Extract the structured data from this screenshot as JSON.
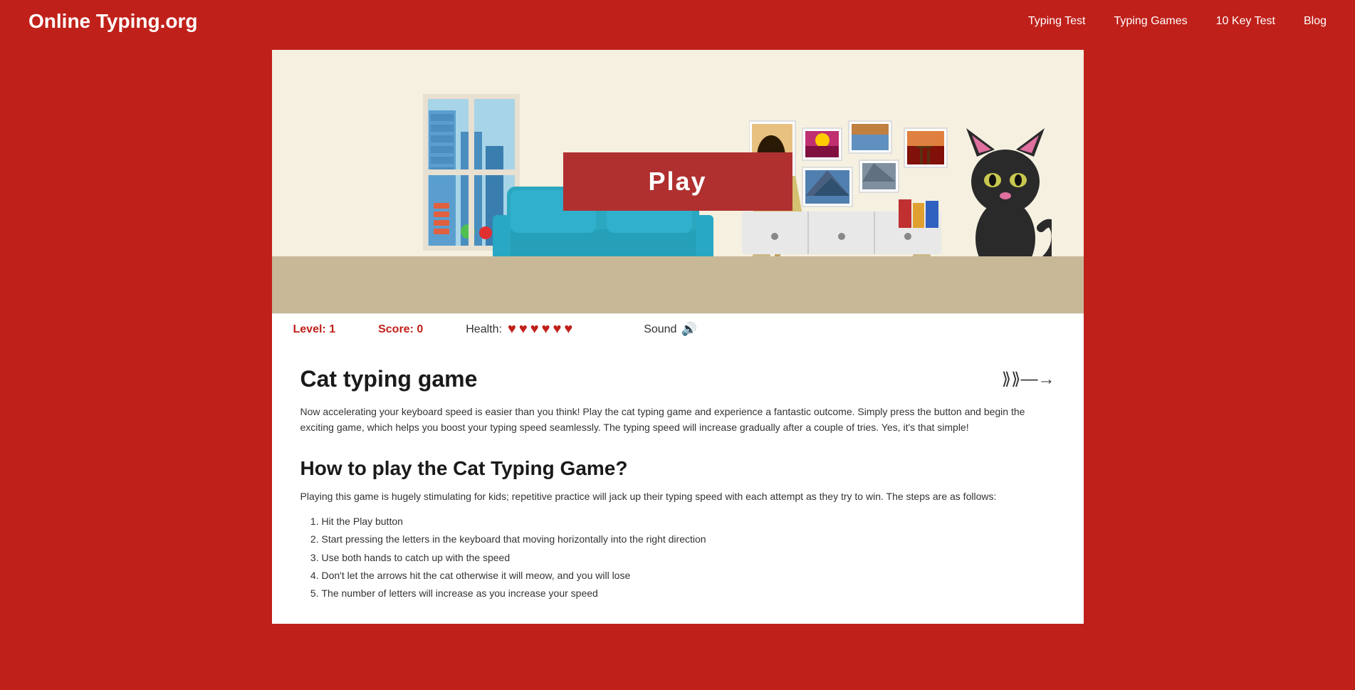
{
  "header": {
    "logo": "Online Typing.org",
    "nav": [
      {
        "label": "Typing Test",
        "href": "#"
      },
      {
        "label": "Typing Games",
        "href": "#"
      },
      {
        "label": "10 Key Test",
        "href": "#"
      },
      {
        "label": "Blog",
        "href": "#"
      }
    ]
  },
  "game": {
    "play_button_label": "Play",
    "level_label": "Level: 1",
    "score_label": "Score: 0",
    "health_label": "Health:",
    "heart_count": 6,
    "sound_label": "Sound"
  },
  "content": {
    "title": "Cat typing game",
    "description": "Now accelerating your keyboard speed is easier than you think! Play the cat typing game and experience a fantastic outcome. Simply press the button and begin the exciting game, which helps you boost your typing speed seamlessly. The typing speed will increase gradually after a couple of tries. Yes, it's that simple!",
    "how_to_title": "How to play the Cat Typing Game?",
    "how_to_intro": "Playing this game is hugely stimulating for kids; repetitive practice will jack up their typing speed with each attempt as they try to win. The steps are as follows:",
    "steps": [
      "Hit the Play button",
      "Start pressing the letters in the keyboard that moving horizontally into the right direction",
      "Use both hands to catch up with the speed",
      "Don't let the arrows hit the cat otherwise it will meow, and you will lose",
      "The number of letters will increase as you increase your speed"
    ]
  }
}
